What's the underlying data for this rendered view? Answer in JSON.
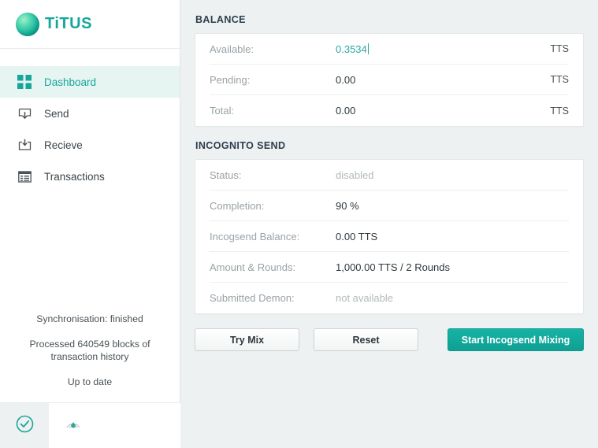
{
  "brand": {
    "name": "TiTUS",
    "logo_icon": "titus-sphere-logo",
    "accent_color": "#17a79a"
  },
  "sidebar": {
    "nav": [
      {
        "label": "Dashboard",
        "icon": "grid-icon",
        "active": true
      },
      {
        "label": "Send",
        "icon": "send-box-icon",
        "active": false
      },
      {
        "label": "Recieve",
        "icon": "receive-tray-icon",
        "active": false
      },
      {
        "label": "Transactions",
        "icon": "list-window-icon",
        "active": false
      }
    ],
    "sync": {
      "status": "Synchronisation: finished",
      "blocks": "Processed 640549 blocks of transaction history",
      "uptodate": "Up to date"
    },
    "statusbar": {
      "sync_icon": "check-circle-icon",
      "network_icon": "signal-broadcast-icon"
    }
  },
  "main": {
    "balance": {
      "title": "BALANCE",
      "rows": [
        {
          "label": "Available:",
          "value": "0.3534",
          "unit": "TTS",
          "style": "accent"
        },
        {
          "label": "Pending:",
          "value": "0.00",
          "unit": "TTS",
          "style": "normal"
        },
        {
          "label": "Total:",
          "value": "0.00",
          "unit": "TTS",
          "style": "normal"
        }
      ]
    },
    "incognito": {
      "title": "INCOGNITO SEND",
      "rows": [
        {
          "label": "Status:",
          "value": "disabled",
          "style": "muted"
        },
        {
          "label": "Completion:",
          "value": "90 %",
          "style": "normal"
        },
        {
          "label": "Incogsend Balance:",
          "value": "0.00 TTS",
          "style": "normal"
        },
        {
          "label": "Amount & Rounds:",
          "value": "1,000.00 TTS / 2 Rounds",
          "style": "normal"
        },
        {
          "label": "Submitted Demon:",
          "value": "not available",
          "style": "muted"
        }
      ]
    },
    "buttons": {
      "try_mix": "Try Mix",
      "reset": "Reset",
      "start_mixing": "Start Incogsend Mixing"
    }
  }
}
